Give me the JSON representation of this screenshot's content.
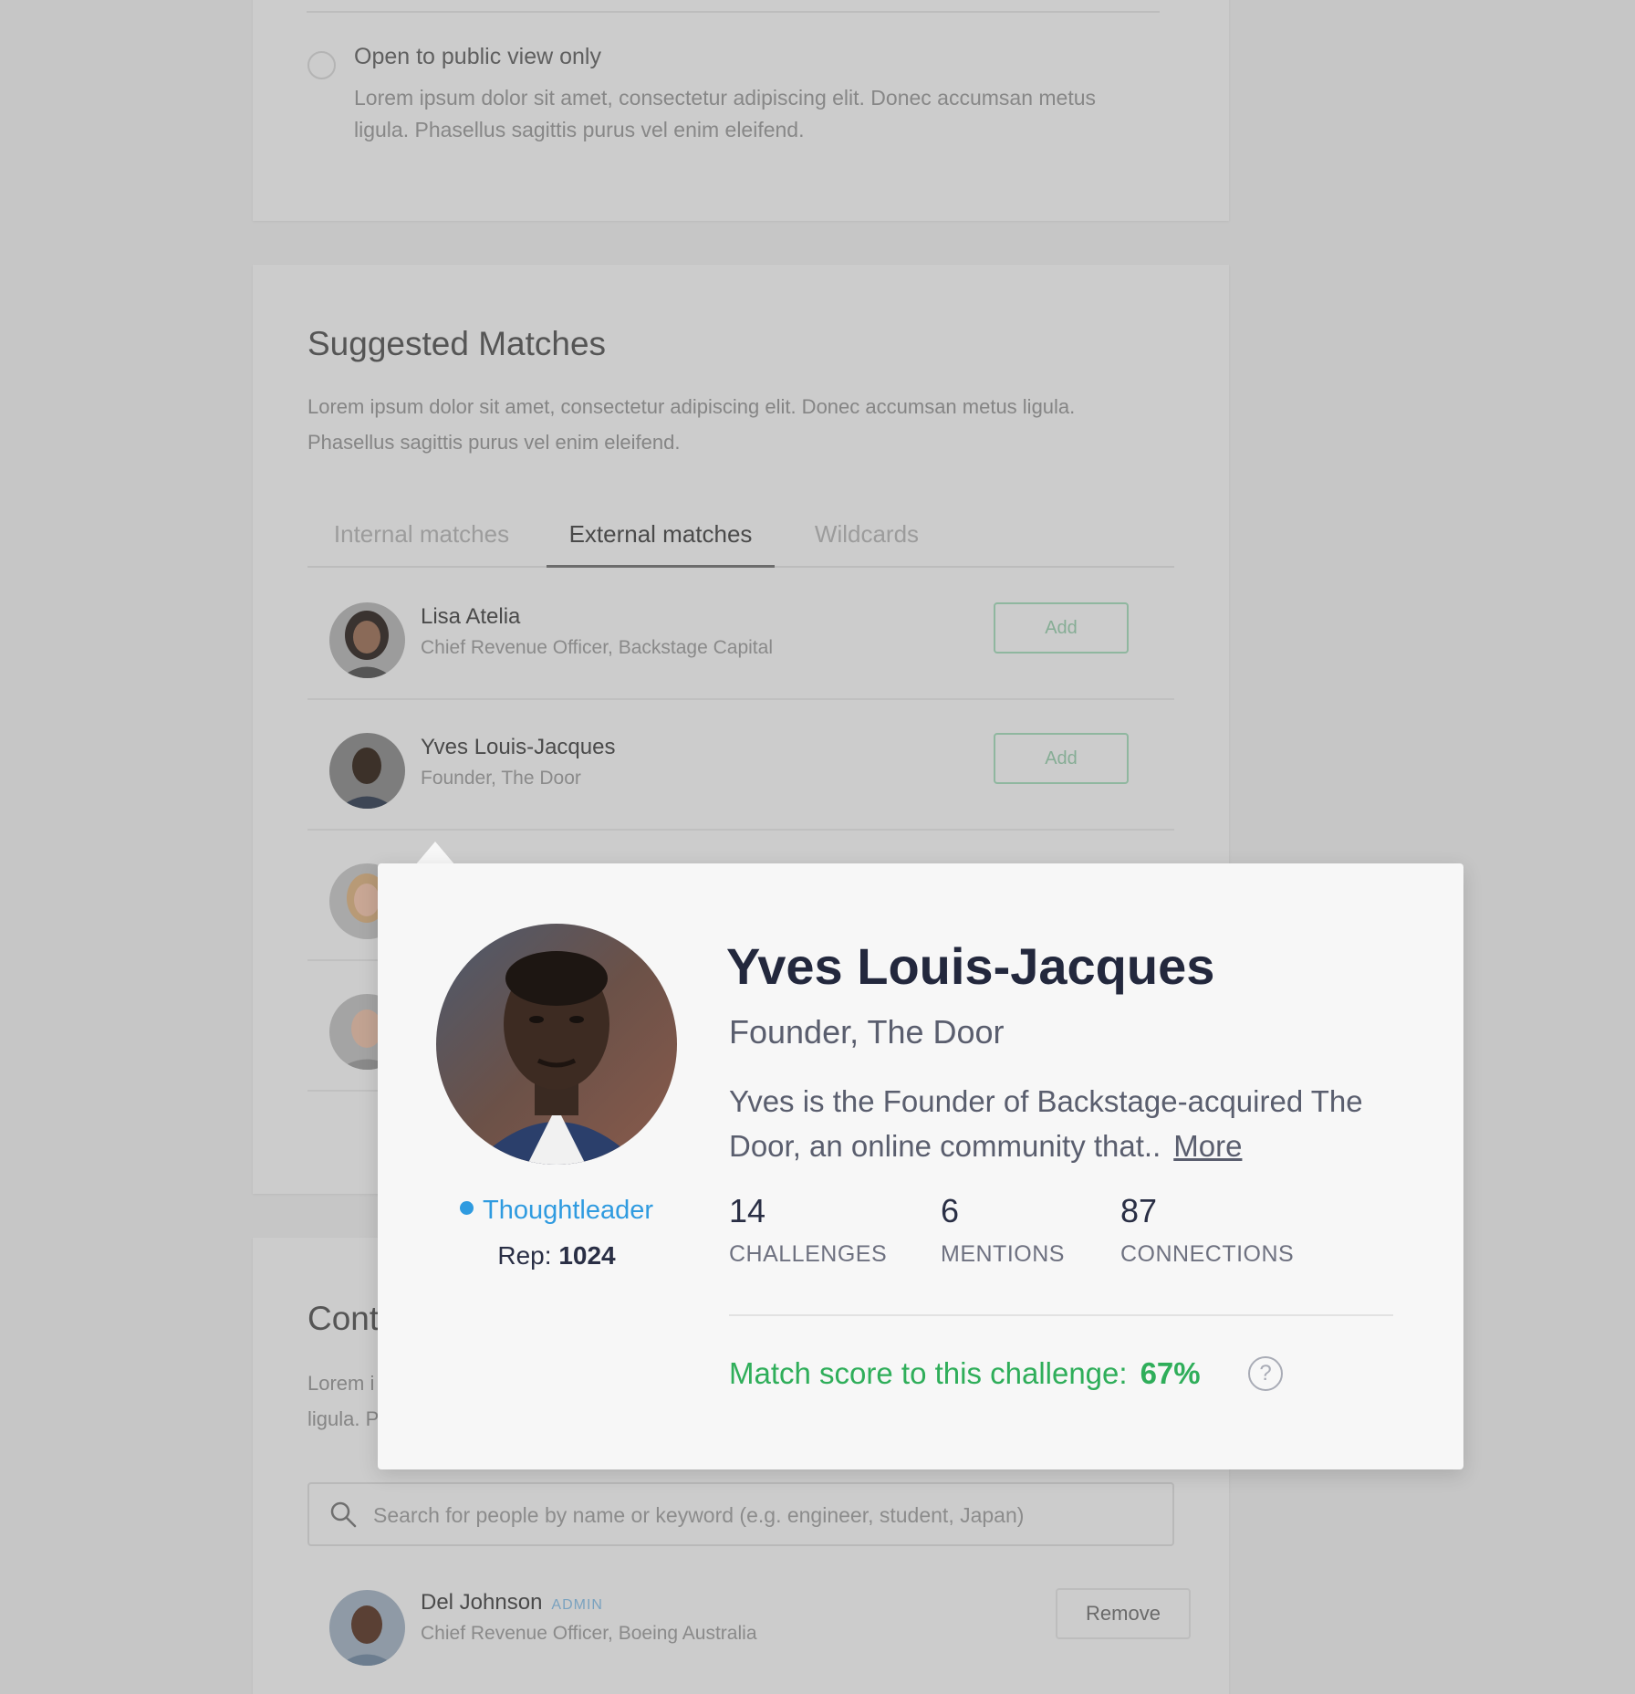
{
  "visibility_option": {
    "title": "Open to public view only",
    "description": "Lorem ipsum dolor sit amet, consectetur adipiscing elit. Donec accumsan metus ligula. Phasellus sagittis purus vel enim eleifend."
  },
  "suggested_matches": {
    "title": "Suggested Matches",
    "description": "Lorem ipsum dolor sit amet, consectetur adipiscing elit. Donec accumsan metus ligula. Phasellus sagittis purus vel enim eleifend.",
    "tabs": [
      {
        "label": "Internal matches",
        "active": false
      },
      {
        "label": "External matches",
        "active": true
      },
      {
        "label": "Wildcards",
        "active": false
      }
    ],
    "rows": [
      {
        "name": "Lisa Atelia",
        "role": "Chief Revenue Officer, Backstage Capital",
        "button": "Add"
      },
      {
        "name": "Yves Louis-Jacques",
        "role": "Founder, The Door",
        "button": "Add"
      }
    ]
  },
  "contacts": {
    "title": "Cont",
    "description_partial_1": "Lorem i",
    "description_partial_2": "ligula. P",
    "search_placeholder": "Search for people by name or keyword (e.g. engineer, student, Japan)",
    "rows": [
      {
        "name": "Del Johnson",
        "badge": "ADMIN",
        "role": "Chief Revenue Officer, Boeing Australia",
        "button": "Remove"
      }
    ]
  },
  "popover": {
    "name": "Yves Louis-Jacques",
    "role": "Founder, The Door",
    "bio": "Yves is the Founder of Backstage-acquired The Door, an online community that..",
    "more_label": "More",
    "tag": "Thoughtleader",
    "rep_label": "Rep:",
    "rep_value": "1024",
    "stats": [
      {
        "value": "14",
        "label": "CHALLENGES"
      },
      {
        "value": "6",
        "label": "MENTIONS"
      },
      {
        "value": "87",
        "label": "CONNECTIONS"
      }
    ],
    "match_label": "Match score to this challenge:",
    "match_value": "67%",
    "help_glyph": "?"
  },
  "colors": {
    "overlay": "#c6c6c6",
    "accent_green": "#2fae5a",
    "tag_blue": "#2f9be0",
    "name_dark": "#23283d"
  }
}
